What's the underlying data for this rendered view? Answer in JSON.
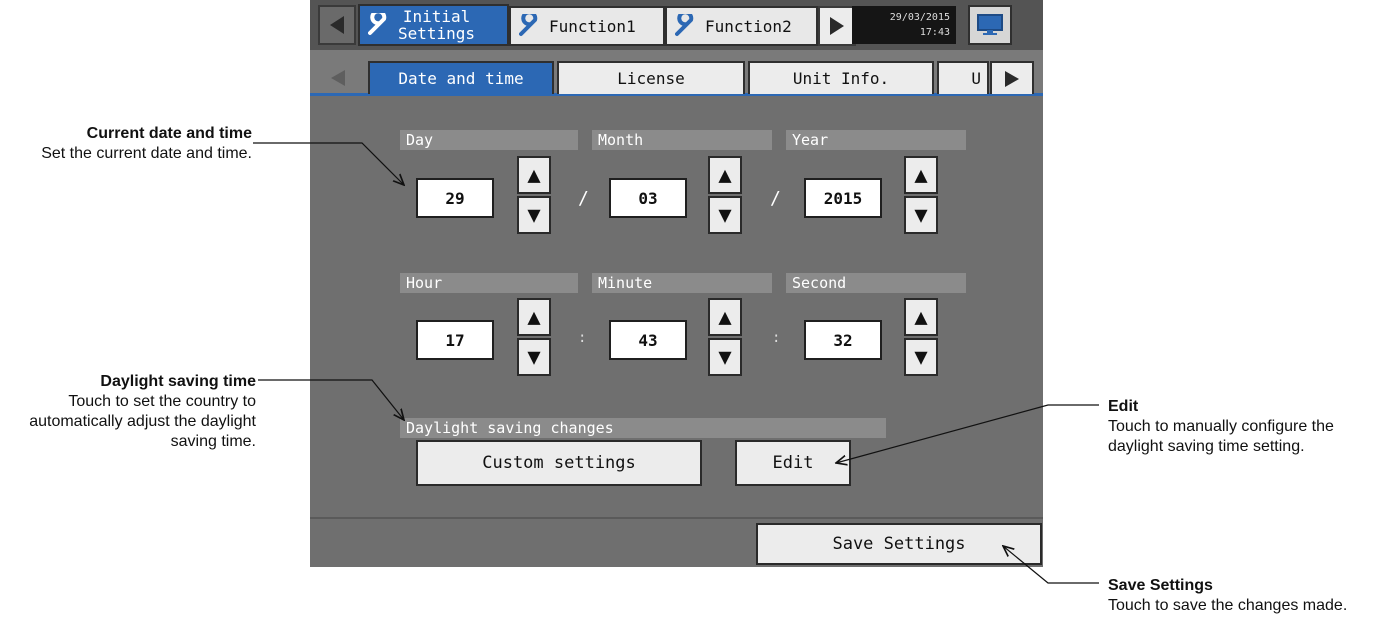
{
  "topbar": {
    "tabs": [
      {
        "label_line1": "Initial",
        "label_line2": "Settings",
        "active": true
      },
      {
        "label": "Function1",
        "active": false
      },
      {
        "label": "Function2",
        "active": false
      }
    ],
    "clock_date": "29/03/2015",
    "clock_time": "17:43"
  },
  "subtabs": [
    {
      "label": "Date and time",
      "active": true
    },
    {
      "label": "License"
    },
    {
      "label": "Unit Info."
    },
    {
      "label": "U"
    }
  ],
  "date": {
    "day": {
      "label": "Day",
      "value": "29"
    },
    "month": {
      "label": "Month",
      "value": "03"
    },
    "year": {
      "label": "Year",
      "value": "2015"
    },
    "separator": "/"
  },
  "time": {
    "hour": {
      "label": "Hour",
      "value": "17"
    },
    "minute": {
      "label": "Minute",
      "value": "43"
    },
    "second": {
      "label": "Second",
      "value": "32"
    },
    "separator": ":"
  },
  "dst": {
    "header": "Daylight saving changes",
    "custom_label": "Custom settings",
    "edit_label": "Edit"
  },
  "save_label": "Save Settings",
  "annotations": {
    "current": {
      "title": "Current date and time",
      "desc": "Set the current date and time."
    },
    "dst": {
      "title": "Daylight saving time",
      "desc": "Touch to set the country to automatically adjust the daylight saving time."
    },
    "edit": {
      "title": "Edit",
      "desc": "Touch to manually configure the daylight saving time setting."
    },
    "save": {
      "title": "Save Settings",
      "desc": "Touch to save the changes made."
    }
  },
  "icons": {
    "prev": "left-arrow-icon",
    "next": "right-arrow-icon",
    "wrench": "wrench-icon",
    "up": "up-arrow-icon",
    "down": "down-arrow-icon",
    "monitor": "monitor-icon"
  },
  "colors": {
    "active_tab": "#2c68b4",
    "panel_bg": "#6f6f6f",
    "header_bg": "#8b8b8b"
  }
}
